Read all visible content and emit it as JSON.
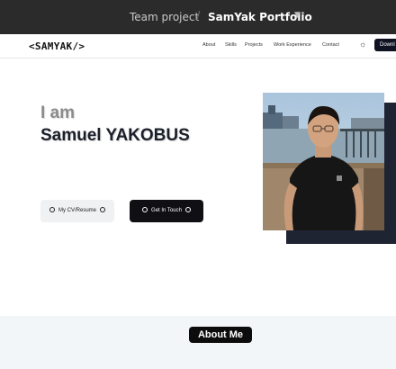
{
  "topbar": {
    "team": "Team project",
    "separator": "/",
    "project": "SamYak Portfolio",
    "chevron_icon": "chevron-down-icon"
  },
  "nav": {
    "logo": "<SAMYAK/>",
    "links": [
      "About",
      "Skills",
      "Projects",
      "Work Experience",
      "Contact"
    ],
    "theme_icon": "sun-icon",
    "download_label": "Downl"
  },
  "hero": {
    "intro": "I am",
    "name": "Samuel YAKOBUS",
    "cv_button": "My CV/Resume",
    "contact_button": "Get In Touch"
  },
  "about": {
    "title": "About Me"
  },
  "colors": {
    "topbar_bg": "#2b2b2b",
    "dark_button": "#0f0f14",
    "photo_shadow": "#1f2433",
    "about_bg": "#f3f6f9"
  }
}
